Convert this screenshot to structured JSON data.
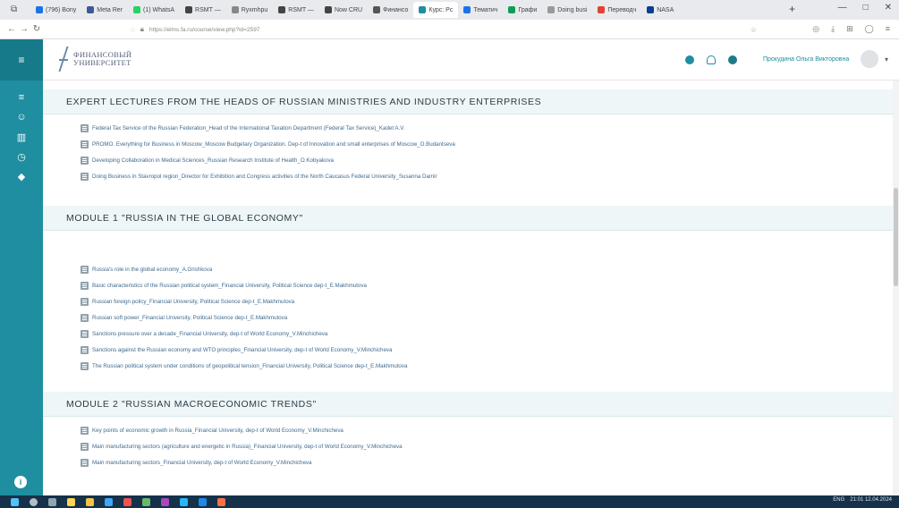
{
  "browser": {
    "tabs": [
      {
        "label": "(796) Bony",
        "color": "#1a73e8"
      },
      {
        "label": "Meta Rer",
        "color": "#3b5998"
      },
      {
        "label": "(1) WhatsA",
        "color": "#25d366"
      },
      {
        "label": "RSMT —",
        "color": "#444444"
      },
      {
        "label": "Ryxmhpu",
        "color": "#888888"
      },
      {
        "label": "RSMT —",
        "color": "#444444"
      },
      {
        "label": "Now CRU",
        "color": "#444444"
      },
      {
        "label": "Финансо",
        "color": "#555555"
      },
      {
        "label": "Курс: Рс",
        "color": "#1e8ea0",
        "active": true
      },
      {
        "label": "Тематич",
        "color": "#1a73e8"
      },
      {
        "label": "Графи",
        "color": "#0f9d58"
      },
      {
        "label": "Doing busi",
        "color": "#999999"
      },
      {
        "label": "Переводч",
        "color": "#e34133"
      },
      {
        "label": "NASA",
        "color": "#0b3d91"
      }
    ],
    "url": "https://elms.fa.ru/course/view.php?id=2597",
    "window_controls": [
      "—",
      "□",
      "✕"
    ]
  },
  "sidebar": {
    "menu_icon": "hamburger-icon",
    "items": [
      {
        "icon": "dashboard-icon",
        "glyph": "≡"
      },
      {
        "icon": "users-icon",
        "glyph": "☺"
      },
      {
        "icon": "book-icon",
        "glyph": "▥"
      },
      {
        "icon": "clock-icon",
        "glyph": "◷"
      },
      {
        "icon": "cap-icon",
        "glyph": "◆"
      }
    ],
    "bottom_icon": "info-icon"
  },
  "header": {
    "logo_line1": "ФИНАНСОВЫЙ",
    "logo_line2": "УНИВЕРСИТЕТ",
    "user_name": "Прокудина Ольга Викторовна"
  },
  "sections": [
    {
      "title": "EXPERT LECTURES FROM THE HEADS OF RUSSIAN MINISTRIES AND INDUSTRY ENTERPRISES",
      "items": [
        "Federal Tax Service of the Russian Federation_Head of the International Taxation Department (Federal Tax Service)_Kadet A.V.",
        "PROMO. Everything for Business in Moscow_Moscow Budgetary Organization. Dep-t of Innovation and small enterprises of Moscow_O.Budantseva",
        "Developing Collaboration in Medical Sciences_Russian Research Institute of Health_O.Kobyakova",
        "Doing Business in Stavropol region_Director for Exhibition and Congress activities of the North Caucasus Federal University_Susanna Damir"
      ]
    },
    {
      "title": "MODULE 1 \"RUSSIA IN THE GLOBAL ECONOMY\"",
      "items": [
        "Russia's role in the global economy_A.Grishkova",
        "Basic characteristics of the Russian political system_Financial University, Political Science dep-t_E.Makhmutova",
        "Russian foreign policy_Financial University, Political Science dep-t_E.Makhmutova",
        "Russian soft power_Financial University, Political Science dep-t_E.Makhmutova",
        "Sanctions pressure over a decade_Financial University, dep-t of World Economy_V.Minchicheva",
        "Sanctions against the Russian economy and WTO principles_Financial University, dep-t of World Economy_V.Minchicheva",
        "The Russian political system under conditions of geopolitical tension_Financial University, Political Science dep-t_E.Makhmutova"
      ]
    },
    {
      "title": "MODULE 2 \"RUSSIAN MACROECONOMIC TRENDS\"",
      "items": [
        "Key points of economic growth in Russia_Financial University, dep-t of World Economy_V.Minchicheva",
        "Main manufacturing sectors (agriculture and energetic in Russia)_Financial University, dep-t of World Economy_V.Minchicheva",
        "Main manufacturing sectors_Financial University, dep-t of World Economy_V.Minchicheva"
      ]
    }
  ],
  "taskbar": {
    "tray_text": "ENG",
    "time": "21:01",
    "date": "12.04.2024"
  }
}
